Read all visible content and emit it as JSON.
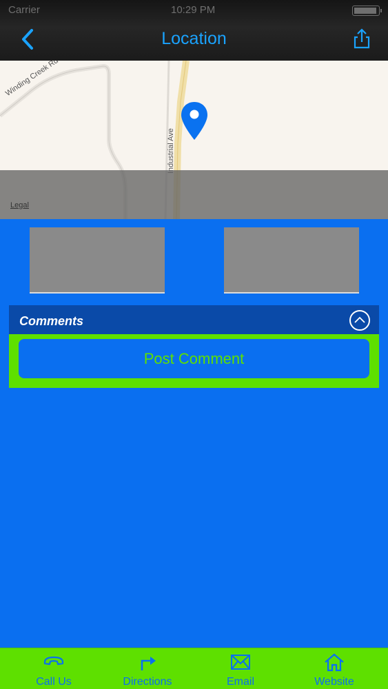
{
  "status_bar": {
    "carrier": "Carrier",
    "time": "10:29 PM"
  },
  "header": {
    "title": "Location"
  },
  "map": {
    "road_labels": [
      "Winding Creek Rd",
      "Industrial Ave"
    ],
    "legal": "Legal"
  },
  "comments": {
    "title": "Comments",
    "post_button": "Post Comment"
  },
  "tabbar": {
    "tabs": [
      {
        "label": "Call Us",
        "icon": "phone-icon"
      },
      {
        "label": "Directions",
        "icon": "directions-icon"
      },
      {
        "label": "Email",
        "icon": "email-icon"
      },
      {
        "label": "Website",
        "icon": "home-icon"
      }
    ]
  },
  "colors": {
    "background": "#0a6ff0",
    "accent_green": "#5ee000",
    "title_blue": "#1aa3ff",
    "header_panel": "#0a4aa8"
  }
}
